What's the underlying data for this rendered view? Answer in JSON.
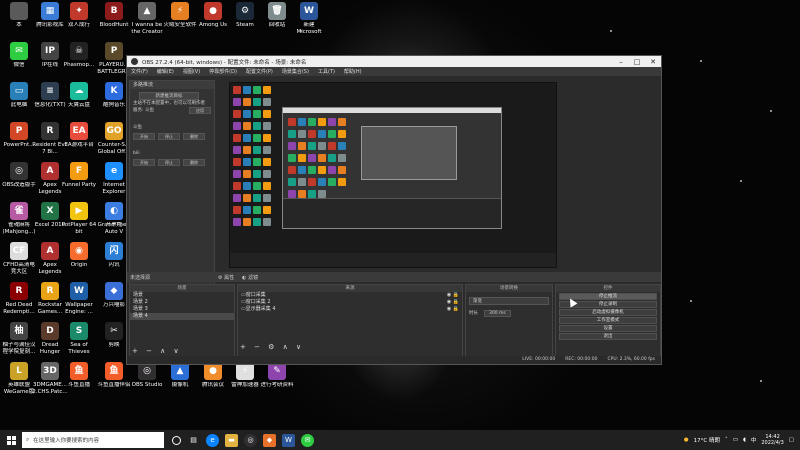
{
  "desktop": {
    "icons": [
      {
        "label": "本",
        "color": "#5a5a5a",
        "glyph": ""
      },
      {
        "label": "腾讯影视库",
        "color": "#3a7bd5",
        "glyph": "▦"
      },
      {
        "label": "双人成行",
        "color": "#c0392b",
        "glyph": "✦"
      },
      {
        "label": "BloodHunt",
        "color": "#8e1b1b",
        "glyph": "B"
      },
      {
        "label": "I wanna be the Creator",
        "color": "#666",
        "glyph": "▲"
      },
      {
        "label": "火绒安全软件",
        "color": "#e67e22",
        "glyph": "⚡"
      },
      {
        "label": "Among Us",
        "color": "#c0392b",
        "glyph": "●"
      },
      {
        "label": "Steam",
        "color": "#1b2838",
        "glyph": "⚙"
      },
      {
        "label": "回收站",
        "color": "#7f8c8d",
        "glyph": "🗑"
      },
      {
        "label": "新建 Microsoft Word...",
        "color": "#2b579a",
        "glyph": "W"
      },
      {
        "label": "微信",
        "color": "#2ecc40",
        "glyph": "✉"
      },
      {
        "label": "IP在线",
        "color": "#444",
        "glyph": "IP"
      },
      {
        "label": "Phasmop...",
        "color": "#222",
        "glyph": "☠"
      },
      {
        "label": "PLAYERU... BATTLEGR...",
        "color": "#5a4a2a",
        "glyph": "P"
      },
      {
        "label": "此电脑",
        "color": "#2980b9",
        "glyph": "▭"
      },
      {
        "label": "信息化(TXT)",
        "color": "#2c3e50",
        "glyph": "≡"
      },
      {
        "label": "天翼云盘",
        "color": "#1abc9c",
        "glyph": "☁"
      },
      {
        "label": "酷狗音乐",
        "color": "#2d6cdf",
        "glyph": "K"
      },
      {
        "label": "PowerPnt...",
        "color": "#d24726",
        "glyph": "P"
      },
      {
        "label": "Resident Evil 7 Bi...",
        "color": "#333",
        "glyph": "R"
      },
      {
        "label": "EA游戏平台",
        "color": "#e74c3c",
        "glyph": "EA"
      },
      {
        "label": "Counter-S... Global Off...",
        "color": "#e1a22a",
        "glyph": "GO"
      },
      {
        "label": "OBS改造版手",
        "color": "#333",
        "glyph": "◎"
      },
      {
        "label": "Apex Legends",
        "color": "#b03030",
        "glyph": "A"
      },
      {
        "label": "Funnel Party",
        "color": "#f39c12",
        "glyph": "F"
      },
      {
        "label": "Internet Explorer",
        "color": "#1e90ff",
        "glyph": "e"
      },
      {
        "label": "雀魂麻将(Mahjong...)",
        "color": "#b65aa3",
        "glyph": "雀"
      },
      {
        "label": "Excel 2016",
        "color": "#217346",
        "glyph": "X"
      },
      {
        "label": "PotPlayer 64 bit",
        "color": "#f1c40f",
        "glyph": "▶"
      },
      {
        "label": "Grand Theft Auto V",
        "color": "#3a7a3a",
        "glyph": "V"
      },
      {
        "label": "CFHD高清电竞大区",
        "color": "#ddd",
        "glyph": "CF"
      },
      {
        "label": "Apex Legends",
        "color": "#b03030",
        "glyph": "A"
      },
      {
        "label": "Origin",
        "color": "#f56c2d",
        "glyph": "◉"
      },
      {
        "label": "闪讯",
        "color": "#2d7fd6",
        "glyph": "闪"
      },
      {
        "label": "Red Dead Redempti...",
        "color": "#8b0000",
        "glyph": "R"
      },
      {
        "label": "Rockstar Games...",
        "color": "#e8a317",
        "glyph": "R"
      },
      {
        "label": "Wallpaper Engine: ...",
        "color": "#1f5fa8",
        "glyph": "W"
      },
      {
        "label": "万兴喵影",
        "color": "#3a6fd8",
        "glyph": "◆"
      },
      {
        "label": "柚子与满佳汉程学院复刻...",
        "color": "#444",
        "glyph": "柚"
      },
      {
        "label": "Dread Hunger",
        "color": "#5a3a2a",
        "glyph": "D"
      },
      {
        "label": "Sea of Thieves",
        "color": "#1b8a6b",
        "glyph": "S"
      },
      {
        "label": "剪映",
        "color": "#222",
        "glyph": "✂"
      },
      {
        "label": "英雄联盟WeGame版",
        "color": "#c9a227",
        "glyph": "L"
      },
      {
        "label": "3DMGAME... 2.CHS.Patc...",
        "color": "#666",
        "glyph": "3D"
      },
      {
        "label": "斗鱼直播",
        "color": "#f25d2a",
        "glyph": "鱼"
      },
      {
        "label": "斗鱼直播伴侣",
        "color": "#f25d2a",
        "glyph": "鱼"
      },
      {
        "label": "fshumb",
        "color": "#555",
        "glyph": "f"
      },
      {
        "label": "Studio",
        "color": "#555",
        "glyph": "S"
      },
      {
        "label": "OBS Studio",
        "color": "#302e31",
        "glyph": "◎"
      },
      {
        "label": "摄像机",
        "color": "#2b6fd6",
        "glyph": "▲"
      },
      {
        "label": "腾讯会议",
        "color": "#f08c2a",
        "glyph": "●"
      },
      {
        "label": "雷神加速器",
        "color": "#e0e0e0",
        "glyph": "⚡"
      },
      {
        "label": "进行考研资料",
        "color": "#8e44ad",
        "glyph": "✎"
      },
      {
        "label": "开黑啦",
        "color": "#3b7de0",
        "glyph": "◐"
      }
    ]
  },
  "obs": {
    "title": "OBS 27.2.4 (64-bit, windows) - 配置文件: 未命名 - 场景: 未命名",
    "menu": [
      "文件(F)",
      "编辑(E)",
      "视图(V)",
      "停靠部件(D)",
      "配置文件(P)",
      "场景集合(S)",
      "工具(T)",
      "帮助(H)"
    ],
    "dock": {
      "title": "多路推流",
      "new_target_button": "新建推流目标",
      "desc": "主站不在本配置中，也可以可刷作者",
      "platform": "服务: 斗鱼",
      "apply_label": "应用",
      "sections": [
        {
          "name": "斗鱼",
          "buttons": [
            "开始",
            "停止",
            "删除"
          ]
        },
        {
          "name": "bili",
          "buttons": [
            "开始",
            "停止",
            "删除"
          ]
        }
      ]
    },
    "scene_bar": {
      "label": "未选择源",
      "props": "属性",
      "filters": "滤镜"
    },
    "scenes": {
      "header": "场景",
      "items": [
        "场景",
        "场景 2",
        "场景 3",
        "场景 4"
      ],
      "selected_index": 3,
      "footer": "+ − ∧ ∨"
    },
    "sources": {
      "header": "来源",
      "items": [
        "窗口采集",
        "窗口采集 2",
        "显示器采集 4"
      ],
      "footer": "+ − ⚙ ∧ ∨",
      "tabs": [
        "来源",
        "场景转换"
      ]
    },
    "mixer": {
      "header": "场景转换",
      "transition": "渐变",
      "duration_label": "时长",
      "duration_value": "300 ms"
    },
    "controls": {
      "header": "控件",
      "buttons": [
        "停止推流",
        "停止录制",
        "启动虚拟摄像机",
        "工作室模式",
        "设置",
        "退出"
      ],
      "active_index": 0
    },
    "status": {
      "live": "LIVE: 00:00:00",
      "rec": "REC: 00:00:00",
      "cpu": "CPU: 2.3%, 60.00 fps"
    }
  },
  "taskbar": {
    "search_placeholder": "在这里输入你要搜索的内容",
    "weather": "17°C 晴朗",
    "time": "14:42",
    "date": "2022/4/3"
  }
}
